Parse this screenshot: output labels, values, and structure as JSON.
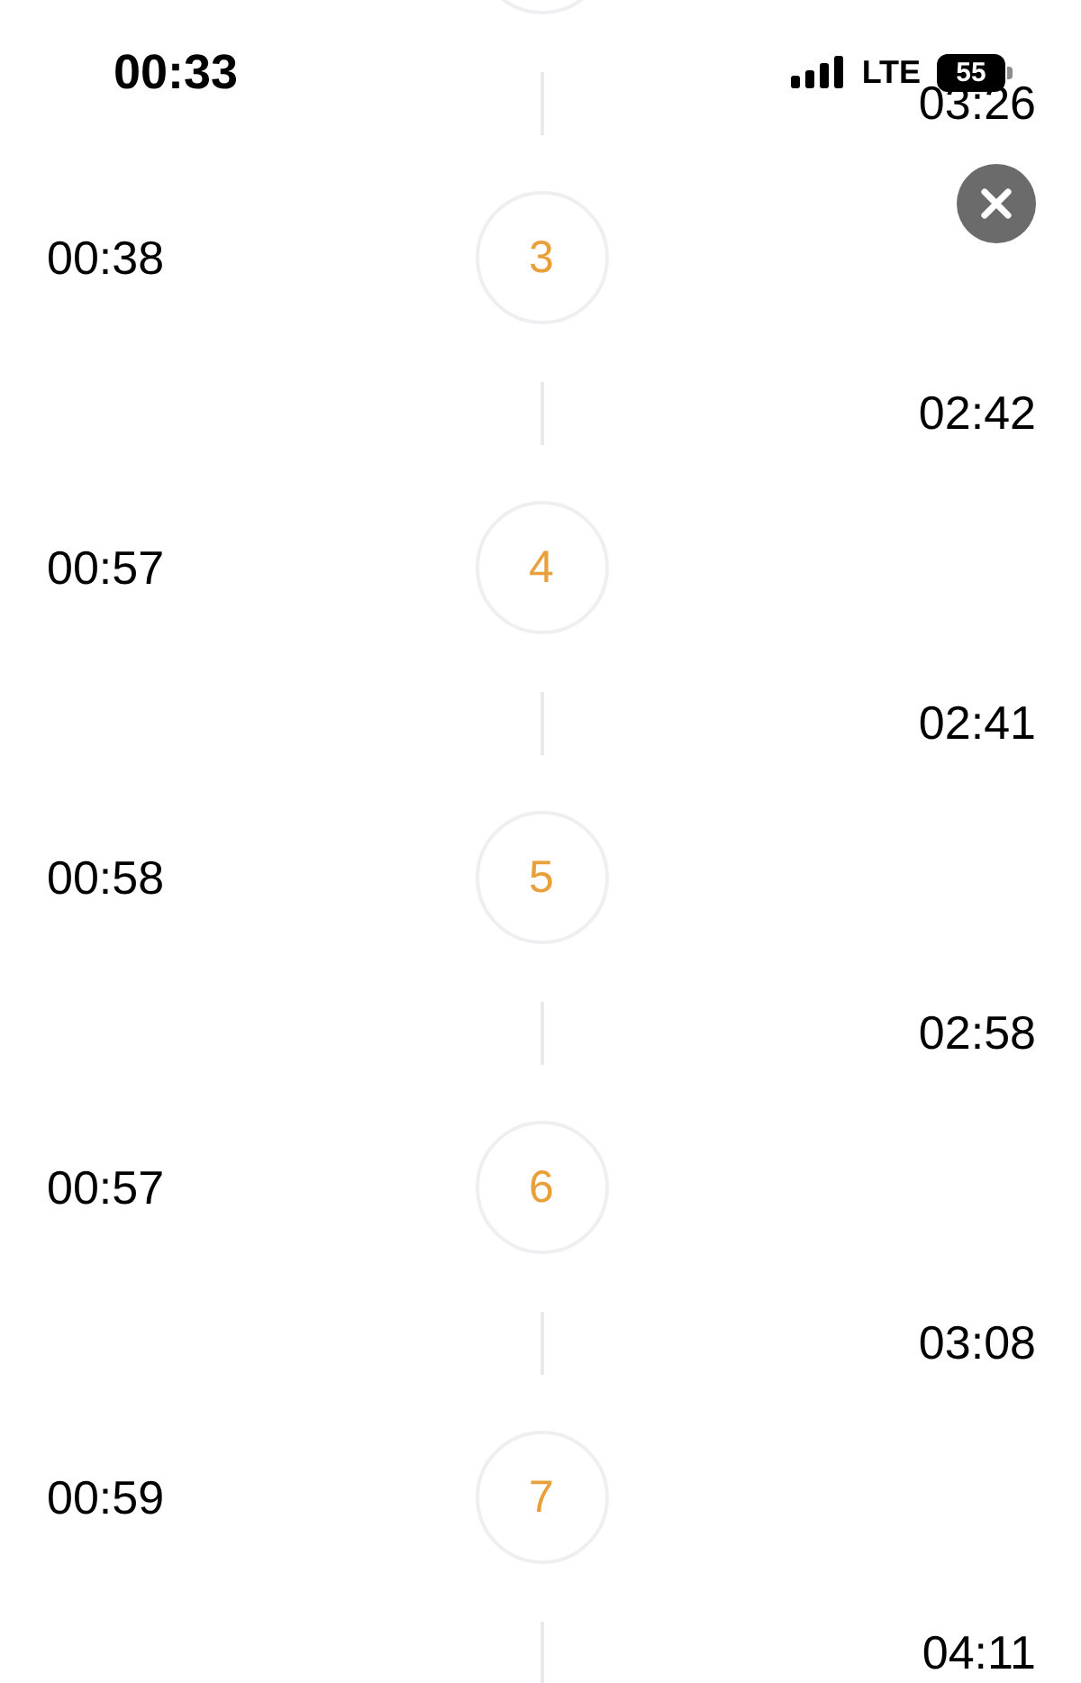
{
  "status_bar": {
    "time": "00:33",
    "network": "LTE",
    "battery": "55"
  },
  "timeline": [
    {
      "kind": "step"
    },
    {
      "kind": "gap",
      "time": "03:26"
    },
    {
      "kind": "step",
      "number": "3",
      "time": "00:38"
    },
    {
      "kind": "gap",
      "time": "02:42"
    },
    {
      "kind": "step",
      "number": "4",
      "time": "00:57"
    },
    {
      "kind": "gap",
      "time": "02:41"
    },
    {
      "kind": "step",
      "number": "5",
      "time": "00:58"
    },
    {
      "kind": "gap",
      "time": "02:58"
    },
    {
      "kind": "step",
      "number": "6",
      "time": "00:57"
    },
    {
      "kind": "gap",
      "time": "03:08"
    },
    {
      "kind": "step",
      "number": "7",
      "time": "00:59"
    },
    {
      "kind": "gap",
      "time": "04:11"
    }
  ]
}
